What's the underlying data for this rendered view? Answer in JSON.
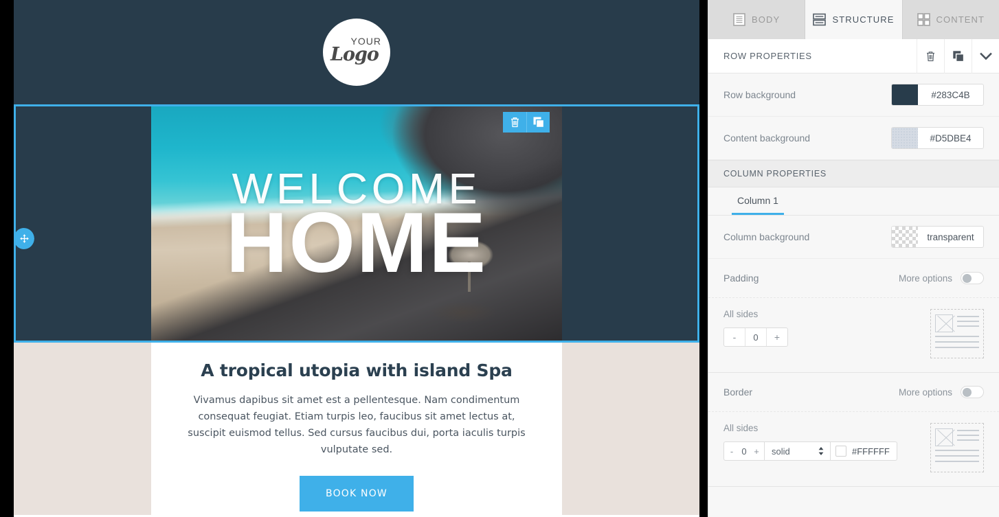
{
  "panel": {
    "tabs": [
      {
        "label": "BODY",
        "icon": "document-lines-icon",
        "active": false
      },
      {
        "label": "STRUCTURE",
        "icon": "stacked-rows-icon",
        "active": true
      },
      {
        "label": "CONTENT",
        "icon": "grid-blocks-icon",
        "active": false
      }
    ],
    "row_properties": {
      "title": "ROW PROPERTIES",
      "actions": [
        "trash-icon",
        "duplicate-icon",
        "chevron-down-icon"
      ],
      "fields": [
        {
          "label": "Row background",
          "value": "#283C4B",
          "swatch": "#283C4B",
          "swatch_kind": "solid"
        },
        {
          "label": "Content background",
          "value": "#D5DBE4",
          "swatch": "#D5DBE4",
          "swatch_kind": "dotted"
        }
      ]
    },
    "column_properties": {
      "title": "COLUMN PROPERTIES",
      "column_tabs": [
        "Column 1"
      ],
      "background": {
        "label": "Column background",
        "value": "transparent",
        "swatch_kind": "checker"
      },
      "padding": {
        "label": "Padding",
        "more_options": "More options",
        "toggle_on": false,
        "all_sides_label": "All sides",
        "minus": "-",
        "value": "0",
        "plus": "+"
      },
      "border": {
        "label": "Border",
        "more_options": "More options",
        "toggle_on": false,
        "all_sides_label": "All sides",
        "minus": "-",
        "value": "0",
        "plus": "+",
        "style": "solid",
        "color": "#FFFFFF"
      }
    }
  },
  "email": {
    "header": {
      "row_background": "#283C4B",
      "logo": {
        "top_text": "YOUR",
        "main_text": "Logo"
      }
    },
    "hero": {
      "selected": true,
      "row_background": "#283C4B",
      "headline_light": "WELCOME",
      "headline_bold": "HOME",
      "toolbar": [
        "trash-icon",
        "duplicate-icon"
      ],
      "drag_handle": "move-icon",
      "selection_color": "#3FB0E9"
    },
    "content": {
      "content_background": "#E9E1DC",
      "title": "A tropical utopia with island Spa",
      "body": "Vivamus dapibus sit amet est a pellentesque. Nam condimentum consequat feugiat. Etiam turpis leo, faucibus sit amet lectus at, suscipit euismod tellus. Sed cursus faucibus dui, porta iaculis turpis vulputate sed.",
      "button_label": "BOOK NOW",
      "button_color": "#3FB0E9"
    }
  }
}
